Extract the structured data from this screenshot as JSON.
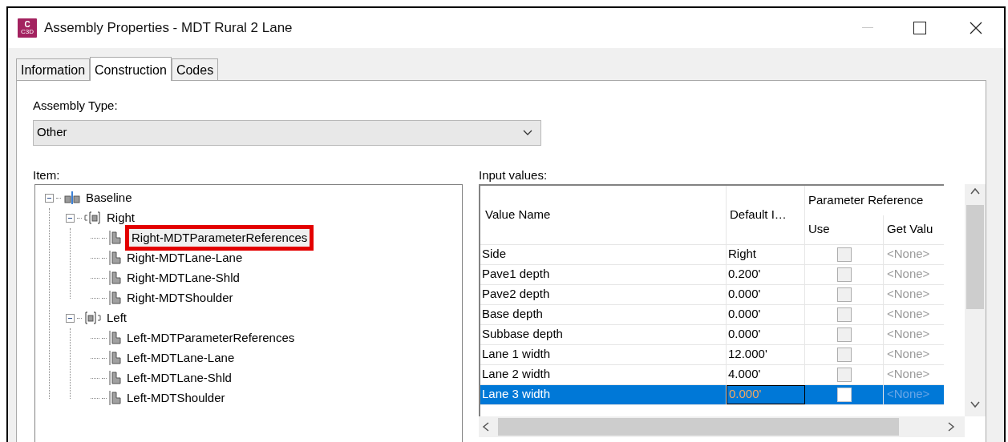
{
  "window": {
    "title": "Assembly Properties - MDT Rural 2 Lane",
    "app_icon": {
      "letter": "C",
      "caption": "C3D"
    }
  },
  "tabs": [
    {
      "label": "Information",
      "selected": false
    },
    {
      "label": "Construction",
      "selected": true
    },
    {
      "label": "Codes",
      "selected": false
    }
  ],
  "assembly_type": {
    "label": "Assembly Type:",
    "value": "Other"
  },
  "item_tree": {
    "label": "Item:",
    "items": [
      {
        "label": "Baseline",
        "kind": "baseline",
        "expanded": true,
        "children": [
          {
            "label": "Right",
            "kind": "right",
            "expanded": true,
            "children": [
              {
                "label": "Right-MDTParameterReferences",
                "kind": "subassembly",
                "highlighted": true
              },
              {
                "label": "Right-MDTLane-Lane",
                "kind": "subassembly",
                "highlighted": false
              },
              {
                "label": "Right-MDTLane-Shld",
                "kind": "subassembly",
                "highlighted": false
              },
              {
                "label": "Right-MDTShoulder",
                "kind": "subassembly",
                "highlighted": false
              }
            ]
          },
          {
            "label": "Left",
            "kind": "left",
            "expanded": true,
            "children": [
              {
                "label": "Left-MDTParameterReferences",
                "kind": "subassembly",
                "highlighted": false
              },
              {
                "label": "Left-MDTLane-Lane",
                "kind": "subassembly",
                "highlighted": false
              },
              {
                "label": "Left-MDTLane-Shld",
                "kind": "subassembly",
                "highlighted": false
              },
              {
                "label": "Left-MDTShoulder",
                "kind": "subassembly",
                "highlighted": false
              }
            ]
          }
        ]
      }
    ]
  },
  "input_values": {
    "label": "Input values:",
    "columns": {
      "name": "Value Name",
      "default": "Default I…",
      "group": "Parameter Reference",
      "use": "Use",
      "get_value": "Get Valu"
    },
    "rows": [
      {
        "name": "Side",
        "default": "Right",
        "use": false,
        "get_value": "<None>",
        "selected": false
      },
      {
        "name": "Pave1 depth",
        "default": "0.200'",
        "use": false,
        "get_value": "<None>",
        "selected": false
      },
      {
        "name": "Pave2 depth",
        "default": "0.000'",
        "use": false,
        "get_value": "<None>",
        "selected": false
      },
      {
        "name": "Base depth",
        "default": "0.000'",
        "use": false,
        "get_value": "<None>",
        "selected": false
      },
      {
        "name": "Subbase depth",
        "default": "0.000'",
        "use": false,
        "get_value": "<None>",
        "selected": false
      },
      {
        "name": "Lane 1 width",
        "default": "12.000'",
        "use": false,
        "get_value": "<None>",
        "selected": false
      },
      {
        "name": "Lane 2 width",
        "default": "4.000'",
        "use": false,
        "get_value": "<None>",
        "selected": false
      },
      {
        "name": "Lane 3 width",
        "default": "0.000'",
        "use": false,
        "get_value": "<None>",
        "selected": true
      }
    ]
  }
}
